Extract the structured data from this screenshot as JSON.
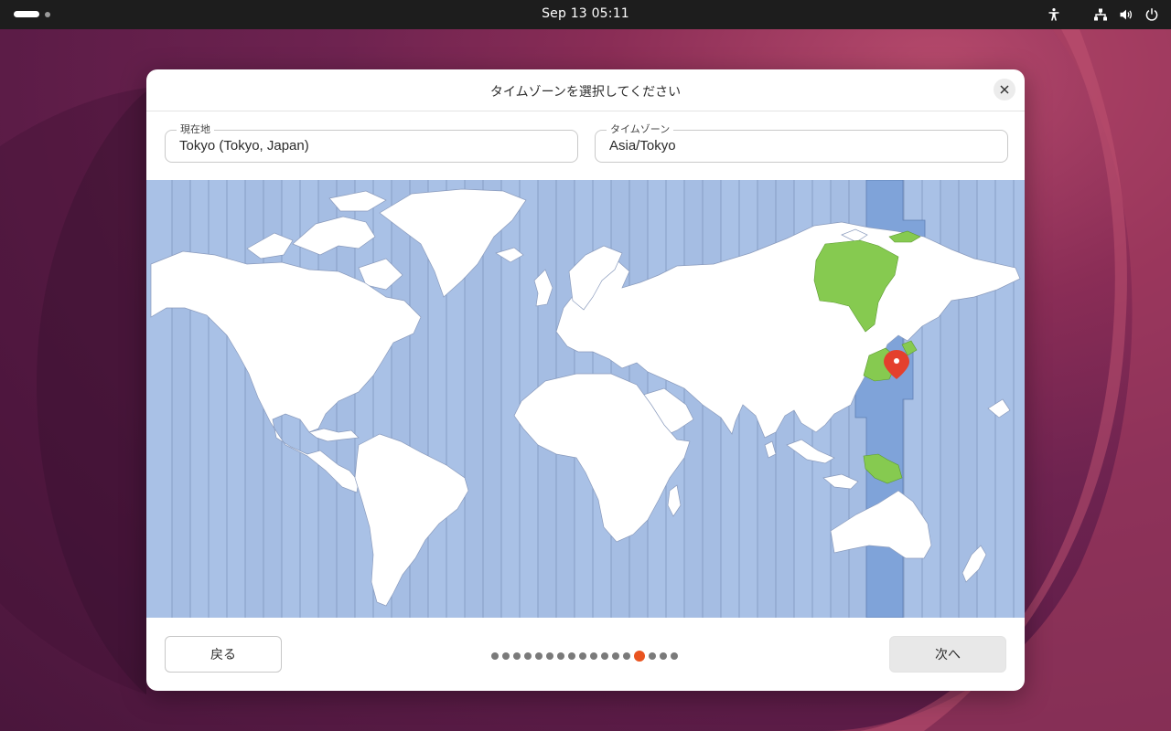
{
  "topbar": {
    "clock": "Sep 13  05:11",
    "icons": [
      "accessibility-icon",
      "network-icon",
      "volume-icon",
      "power-icon"
    ]
  },
  "dialog": {
    "title": "タイムゾーンを選択してください",
    "location": {
      "label": "現在地",
      "value": "Tokyo (Tokyo, Japan)"
    },
    "timezone": {
      "label": "タイムゾーン",
      "value": "Asia/Tokyo"
    },
    "map": {
      "selected_zone": "UTC+09:00",
      "colors": {
        "ocean": "#a9c1e6",
        "land": "#ffffff",
        "selected_band": "#7fa3d9",
        "selected_land": "#86ca50",
        "pin": "#e4402d"
      }
    },
    "back_label": "戻る",
    "next_label": "次へ",
    "progress": {
      "total_steps": 17,
      "current_step": 14
    }
  },
  "colors": {
    "accent": "#e95420",
    "topbar": "#1d1d1d"
  }
}
